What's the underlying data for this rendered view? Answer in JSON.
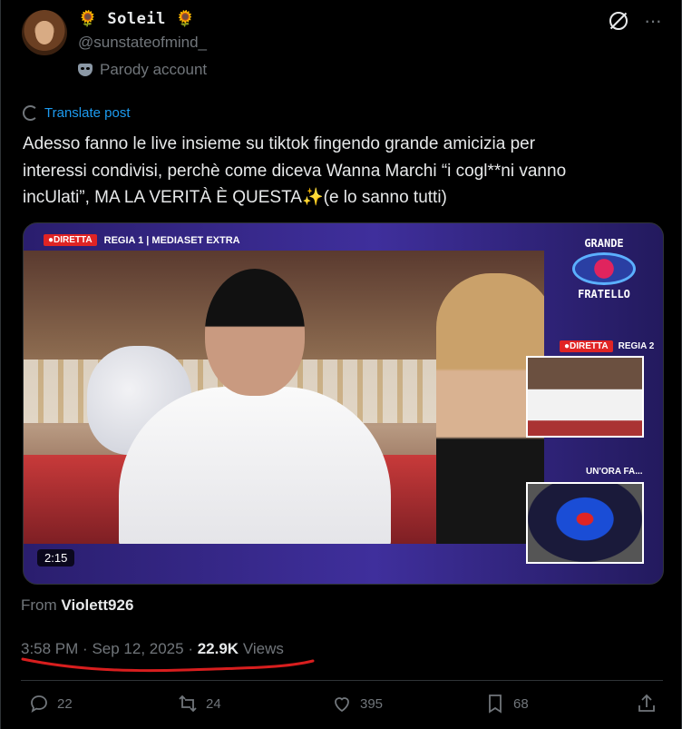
{
  "author": {
    "display_name": "Soleil",
    "name_emoji_left": "🌻",
    "name_emoji_right": "🌻",
    "handle": "@sunstateofmind_",
    "label": "Parody account",
    "label_icon": "mask-icon"
  },
  "header_icons": [
    "grok-icon",
    "more-icon"
  ],
  "translate_label": "Translate post",
  "tweet": {
    "line1": "Adesso fanno le live insieme su tiktok fingendo grande amicizia per",
    "line2": "interessi condivisi, perchè come diceva Wanna Marchi “i cogl**ni vanno",
    "line3_a": "incUlati”, MA LA VERITÀ È QUESTA",
    "line3_emoji": "✨",
    "line3_b": "(e lo sanno tutti)"
  },
  "media": {
    "live_badge": "●DIRETTA",
    "channel": "REGIA 1 | MEDIASET EXTRA",
    "logo_line1": "GRANDE",
    "logo_line2": "FRATELLO",
    "regia2_badge": "●DIRETTA",
    "regia2_label": "REGIA 2",
    "ora_fa": "UN'ORA FA...",
    "duration": "2:15"
  },
  "source": {
    "prefix": "From",
    "name": "Violett926"
  },
  "meta": {
    "time": "3:58 PM",
    "date": "Sep 12, 2025",
    "views_count": "22.9K",
    "views_label": "Views",
    "underline_color": "#d81e1e"
  },
  "actions": {
    "replies": "22",
    "reposts": "24",
    "likes": "395",
    "bookmarks": "68"
  }
}
